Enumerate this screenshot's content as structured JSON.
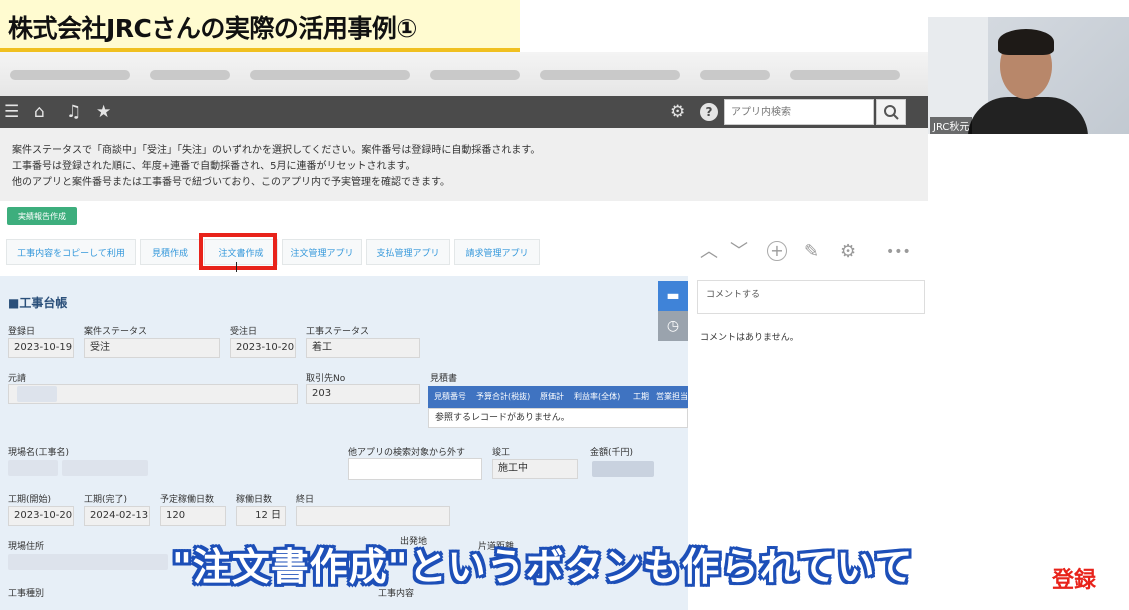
{
  "video": {
    "title": "株式会社JRCさんの実際の活用事例①",
    "subtitle": "\"注文書作成\"というボタンも作られていて",
    "subscribe_logo": "登録",
    "webcam_name": "JRC秋元"
  },
  "header": {
    "icons": [
      "menu-icon",
      "home-icon",
      "bell-icon",
      "star-icon",
      "gear-icon",
      "help-icon",
      "search-icon"
    ],
    "search_placeholder": "アプリ内検索"
  },
  "description": {
    "lines": [
      "案件ステータスで「商談中」「受注」「失注」のいずれかを選択してください。案件番号は登録時に自動採番されます。",
      "工事番号は登録された順に、年度+連番で自動採番され、5月に連番がリセットされます。",
      "他のアプリと案件番号または工事番号で紐づいており、このアプリ内で予実管理を確認できます。"
    ]
  },
  "report_button": "実績報告作成",
  "actions": [
    "工事内容をコピーして利用",
    "見積作成",
    "注文書作成",
    "注文管理アプリ",
    "支払管理アプリ",
    "請求管理アプリ"
  ],
  "toolbar_icons": [
    "chevron-up-icon",
    "chevron-down-icon",
    "plus-icon",
    "edit-icon",
    "gear-icon",
    "more-icon"
  ],
  "record": {
    "section_title": "■工事台帳",
    "fields": {
      "registration_date": {
        "label": "登録日",
        "value": "2023-10-19"
      },
      "case_status": {
        "label": "案件ステータス",
        "value": "受注"
      },
      "order_date": {
        "label": "受注日",
        "value": "2023-10-20"
      },
      "construction_status": {
        "label": "工事ステータス",
        "value": "着工"
      },
      "contractor": {
        "label": "元請"
      },
      "client_no": {
        "label": "取引先No",
        "value": "203"
      },
      "estimate": {
        "label": "見積書"
      },
      "site_name": {
        "label": "現場名(工事名)"
      },
      "exclude_search": {
        "label": "他アプリの検索対象から外す"
      },
      "completion": {
        "label": "竣工",
        "value": "施工中"
      },
      "amount": {
        "label": "金額(千円)"
      },
      "start_date": {
        "label": "工期(開始)",
        "value": "2023-10-20"
      },
      "end_date": {
        "label": "工期(完了)",
        "value": "2024-02-13"
      },
      "planned_days": {
        "label": "予定稼働日数",
        "value": "120"
      },
      "working_days": {
        "label": "稼働日数",
        "value": "12 日"
      },
      "final_date": {
        "label": "終日"
      },
      "site_address": {
        "label": "現場住所"
      },
      "departure": {
        "label": "出発地"
      },
      "one_way_distance": {
        "label": "片道距離"
      },
      "construction_type": {
        "label": "工事種別"
      },
      "construction_detail": {
        "label": "工事内容"
      }
    },
    "estimate_table": {
      "columns": [
        "見積番号",
        "予算合計(税抜)",
        "原価計",
        "利益率(全体)",
        "工期",
        "営業担当"
      ],
      "empty_message": "参照するレコードがありません。"
    }
  },
  "comments": {
    "placeholder": "コメントする",
    "empty_message": "コメントはありません。"
  },
  "colors": {
    "header_bg": "#4b4b4b",
    "report_button": "#3dae7d",
    "highlight": "#e8231b",
    "table_header": "#3f73c1",
    "subtitle_stroke": "#1d4fb8"
  }
}
